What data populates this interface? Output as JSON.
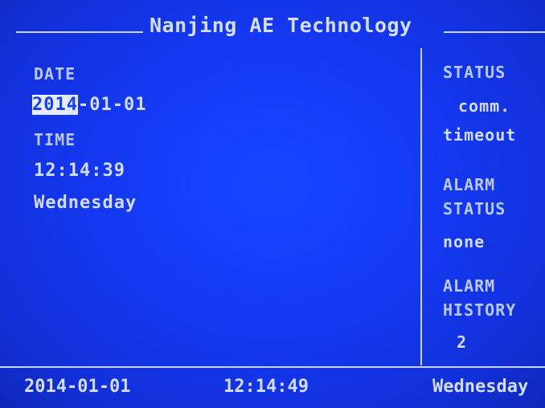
{
  "title": "Nanjing AE Technology",
  "left_panel": {
    "date_label": "DATE",
    "date_year_selected": "201",
    "date_year_cursor": "4",
    "date_rest": "-01-01",
    "time_label": "TIME",
    "time_value": "12:14:39",
    "weekday": "Wednesday"
  },
  "right_panel": {
    "status_label": "STATUS",
    "status_value_line1": "comm.",
    "status_value_line2": "timeout",
    "alarm_status_label_line1": "ALARM",
    "alarm_status_label_line2": "STATUS",
    "alarm_status_value": "none",
    "alarm_history_label_line1": "ALARM",
    "alarm_history_label_line2": "HISTORY",
    "alarm_history_value": "2"
  },
  "status_bar": {
    "date": "2014-01-01",
    "time": "12:14:49",
    "weekday": "Wednesday"
  }
}
